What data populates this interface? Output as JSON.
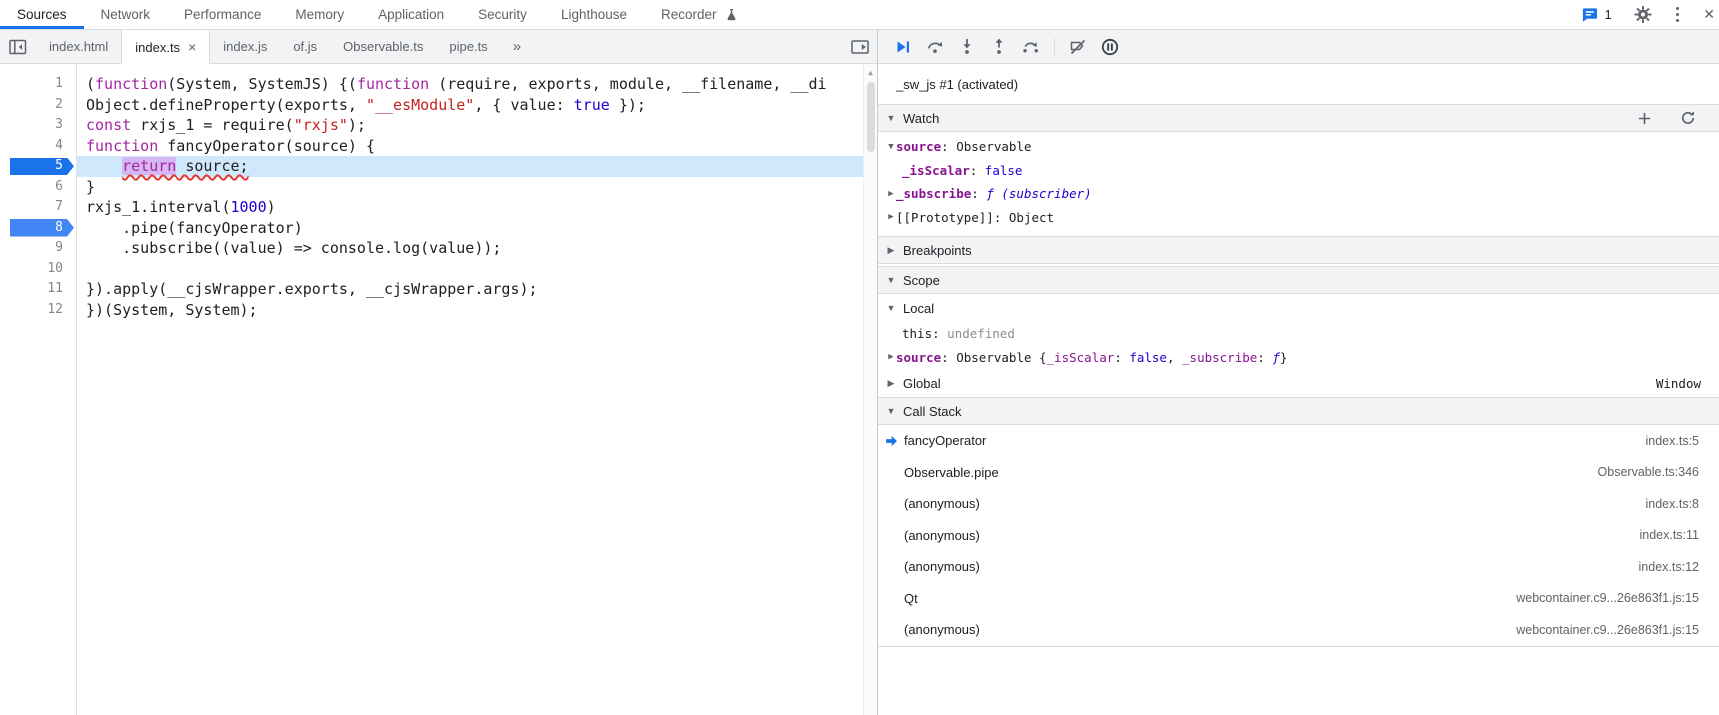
{
  "colors": {
    "accent": "#1a73e8",
    "keyword": "#a626a4",
    "string": "#c5221f",
    "number": "#1c00cf",
    "property": "#881391",
    "breakpoint": "#4285f4",
    "exec_line_bg": "#cfe8fc"
  },
  "top_bar": {
    "tabs": [
      {
        "label": "Sources",
        "active": true
      },
      {
        "label": "Network"
      },
      {
        "label": "Performance"
      },
      {
        "label": "Memory"
      },
      {
        "label": "Application"
      },
      {
        "label": "Security"
      },
      {
        "label": "Lighthouse"
      },
      {
        "label": "Recorder",
        "icon": "flask-icon"
      }
    ],
    "issues_count": "1"
  },
  "file_tab_bar": {
    "tabs": [
      {
        "label": "index.html"
      },
      {
        "label": "index.ts",
        "active": true,
        "closable": true
      },
      {
        "label": "index.js"
      },
      {
        "label": "of.js"
      },
      {
        "label": "Observable.ts"
      },
      {
        "label": "pipe.ts"
      }
    ],
    "overflow": "»"
  },
  "editor": {
    "lines": [
      {
        "n": 1,
        "seg": [
          [
            "(",
            "pl"
          ],
          [
            "function",
            "k"
          ],
          [
            "(System, SystemJS) {(",
            "pl"
          ],
          [
            "function",
            "k"
          ],
          [
            " (require, exports, module, __filename, __di",
            "pl"
          ]
        ]
      },
      {
        "n": 2,
        "seg": [
          [
            "Object.defineProperty(exports, ",
            "pl"
          ],
          [
            "\"__esModule\"",
            "s"
          ],
          [
            ", { value: ",
            "pl"
          ],
          [
            "true",
            "n"
          ],
          [
            " });",
            "pl"
          ]
        ]
      },
      {
        "n": 3,
        "seg": [
          [
            "const",
            "k"
          ],
          [
            " rxjs_1 = require(",
            "pl"
          ],
          [
            "\"rxjs\"",
            "s"
          ],
          [
            ");",
            "pl"
          ]
        ]
      },
      {
        "n": 4,
        "seg": [
          [
            "function",
            "k"
          ],
          [
            " fancyOperator(source) {",
            "pl"
          ]
        ]
      },
      {
        "n": 5,
        "exec": true,
        "breakpoint": true,
        "seg": [
          [
            "    ",
            "pl"
          ],
          [
            "return",
            "k hl err"
          ],
          [
            " source;",
            "pl err"
          ]
        ]
      },
      {
        "n": 6,
        "seg": [
          [
            "}",
            "pl"
          ]
        ]
      },
      {
        "n": 7,
        "seg": [
          [
            "rxjs_1.interval(",
            "pl"
          ],
          [
            "1000",
            "n"
          ],
          [
            ")",
            "pl"
          ]
        ]
      },
      {
        "n": 8,
        "breakpoint": true,
        "seg": [
          [
            "    .pipe(fancyOperator)",
            "pl"
          ]
        ]
      },
      {
        "n": 9,
        "seg": [
          [
            "    .subscribe((value) => console.log(value));",
            "pl"
          ]
        ]
      },
      {
        "n": 10,
        "seg": []
      },
      {
        "n": 11,
        "seg": [
          [
            "}).apply(__cjsWrapper.exports, __cjsWrapper.args);",
            "pl"
          ]
        ]
      },
      {
        "n": 12,
        "seg": [
          [
            "})(System, System);",
            "pl"
          ]
        ]
      }
    ]
  },
  "debugger": {
    "toolbar": {
      "buttons": [
        {
          "icon": "resume-icon"
        },
        {
          "icon": "step-over-icon"
        },
        {
          "icon": "step-into-icon"
        },
        {
          "icon": "step-out-icon"
        },
        {
          "icon": "step-icon"
        },
        {
          "type": "separator"
        },
        {
          "icon": "deactivate-breakpoints-icon"
        },
        {
          "icon": "pause-on-exceptions-icon"
        }
      ]
    },
    "thread": "_sw_js #1 (activated)",
    "watch": {
      "title": "Watch",
      "state_icon": "▼",
      "rows": [
        {
          "arrow": "▼",
          "seg": [
            [
              "source",
              "prop"
            ],
            [
              ": ",
              "pl"
            ],
            [
              "Observable",
              "pl"
            ]
          ]
        },
        {
          "indent": 1,
          "seg": [
            [
              "_isScalar",
              "prop"
            ],
            [
              ": ",
              "pl"
            ],
            [
              "false",
              "n"
            ]
          ]
        },
        {
          "arrow": "▶",
          "seg": [
            [
              "_subscribe",
              "prop"
            ],
            [
              ": ",
              "pl"
            ],
            [
              "ƒ (subscriber)",
              "func"
            ]
          ]
        },
        {
          "arrow": "▶",
          "seg": [
            [
              "[[Prototype]]",
              "pl"
            ],
            [
              ": ",
              "pl"
            ],
            [
              "Object",
              "pl"
            ]
          ]
        }
      ]
    },
    "breakpoints": {
      "title": "Breakpoints",
      "state_icon": "▶"
    },
    "scope": {
      "title": "Scope",
      "state_icon": "▼",
      "rows": [
        {
          "type": "group",
          "arrow": "▼",
          "label": "Local"
        },
        {
          "indent": 1,
          "seg": [
            [
              "this",
              "pl"
            ],
            [
              ": ",
              "pl"
            ],
            [
              "undefined",
              "undef"
            ]
          ]
        },
        {
          "arrow": "▶",
          "seg": [
            [
              "source",
              "prop"
            ],
            [
              ": ",
              "pl"
            ],
            [
              "Observable {",
              "pl"
            ],
            [
              "_isScalar",
              "prop2"
            ],
            [
              ": ",
              "pl"
            ],
            [
              "false",
              "n"
            ],
            [
              ", ",
              "pl"
            ],
            [
              "_subscribe",
              "prop2"
            ],
            [
              ": ",
              "pl"
            ],
            [
              "ƒ",
              "func"
            ],
            [
              "}",
              "pl"
            ]
          ]
        },
        {
          "type": "group",
          "arrow": "▶",
          "label": "Global",
          "right": "Window"
        }
      ]
    },
    "call_stack": {
      "title": "Call Stack",
      "state_icon": "▼",
      "frames": [
        {
          "name": "fancyOperator",
          "location": "index.ts:5",
          "current": true
        },
        {
          "name": "Observable.pipe",
          "location": "Observable.ts:346"
        },
        {
          "name": "(anonymous)",
          "location": "index.ts:8"
        },
        {
          "name": "(anonymous)",
          "location": "index.ts:11"
        },
        {
          "name": "(anonymous)",
          "location": "index.ts:12"
        },
        {
          "name": "Qt",
          "location": "webcontainer.c9...26e863f1.js:15"
        },
        {
          "name": "(anonymous)",
          "location": "webcontainer.c9...26e863f1.js:15"
        }
      ]
    }
  }
}
